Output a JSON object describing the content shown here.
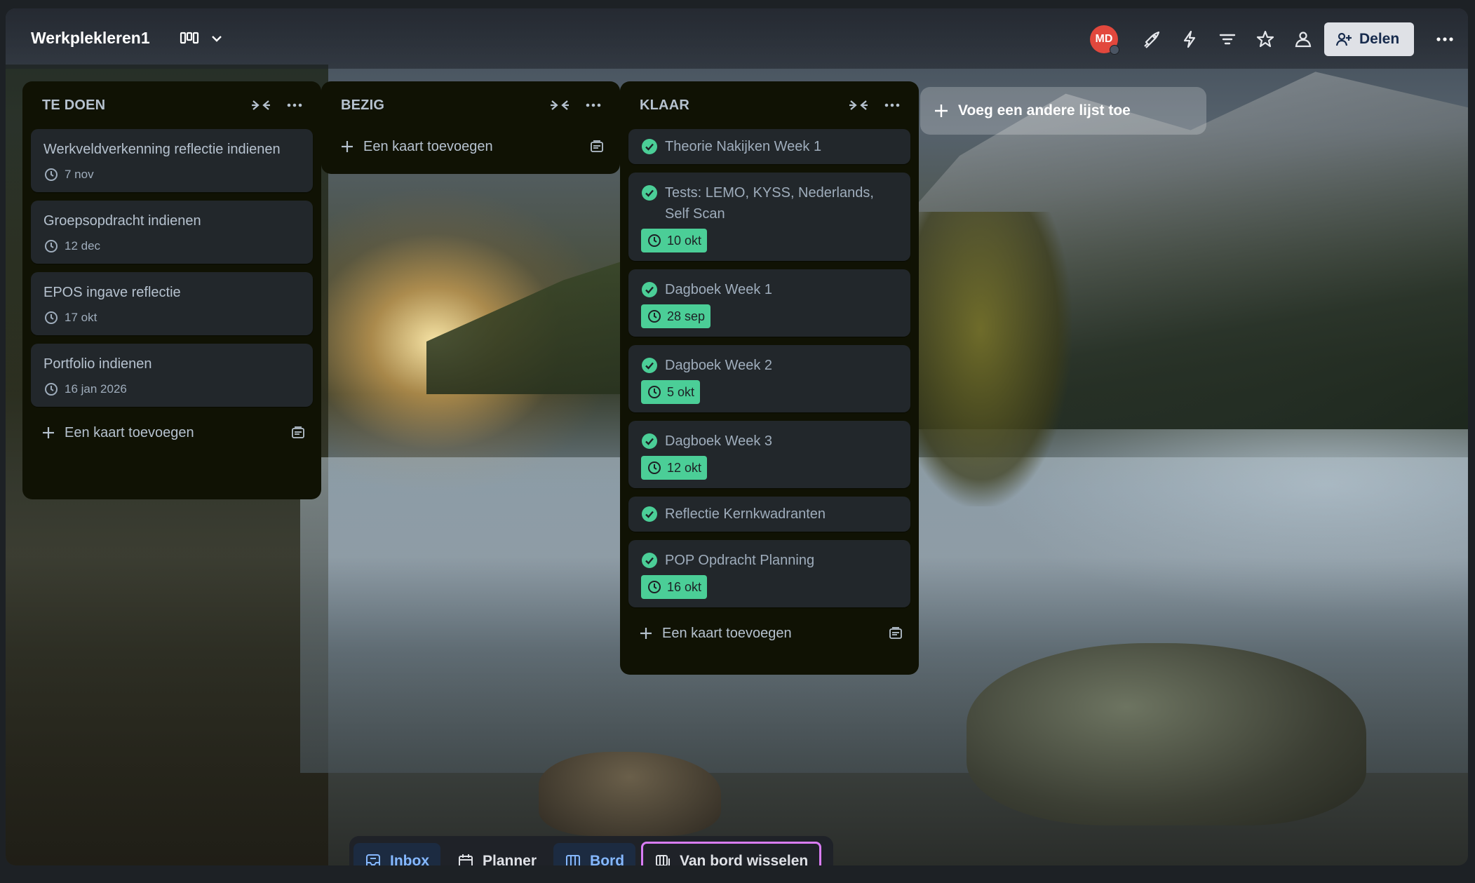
{
  "header": {
    "board_title": "Werkplekleren1",
    "avatar_initials": "MD",
    "share_label": "Delen",
    "icons": [
      "board-view-icon",
      "chevron-down-icon",
      "power-ups-icon",
      "automation-icon",
      "filter-icon",
      "star-icon",
      "visibility-icon",
      "add-member-icon",
      "more-icon"
    ]
  },
  "lists": [
    {
      "title": "TE DOEN",
      "cards": [
        {
          "title": "Werkveldverkenning reflectie indienen",
          "due": "7 nov"
        },
        {
          "title": "Groepsopdracht indienen",
          "due": "12 dec"
        },
        {
          "title": "EPOS ingave reflectie",
          "due": "17 okt"
        },
        {
          "title": "Portfolio indienen",
          "due": "16 jan 2026"
        }
      ],
      "add_card_label": "Een kaart toevoegen"
    },
    {
      "title": "BEZIG",
      "cards": [],
      "add_card_label": "Een kaart toevoegen"
    },
    {
      "title": "KLAAR",
      "cards": [
        {
          "title": "Theorie Nakijken Week 1",
          "due": ""
        },
        {
          "title": "Tests: LEMO, KYSS, Nederlands, Self Scan",
          "due": "10 okt"
        },
        {
          "title": "Dagboek Week 1",
          "due": "28 sep"
        },
        {
          "title": "Dagboek Week 2",
          "due": "5 okt"
        },
        {
          "title": "Dagboek Week 3",
          "due": "12 okt"
        },
        {
          "title": "Reflectie Kernkwadranten",
          "due": ""
        },
        {
          "title": "POP Opdracht Planning",
          "due": "16 okt"
        }
      ],
      "add_card_label": "Een kaart toevoegen"
    }
  ],
  "add_list_label": "Voeg een andere lijst toe",
  "switcher": {
    "inbox": "Inbox",
    "planner": "Planner",
    "board": "Bord",
    "switch_board": "Van bord wisselen"
  },
  "colors": {
    "list_bg": "#101204",
    "card_bg": "#22272b",
    "done_badge": "#4bce97",
    "accent_blue": "#85b8ff",
    "switch_border": "#d97cf5",
    "avatar": "#e2483d"
  }
}
